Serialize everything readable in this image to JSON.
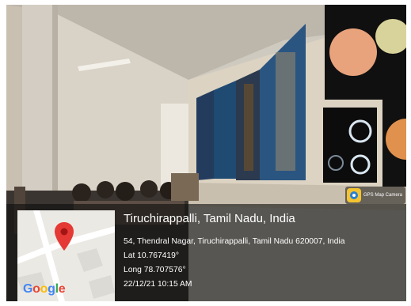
{
  "badge": {
    "app_name": "GPS Map Camera",
    "icon": "gps-map-camera-logo-icon"
  },
  "map": {
    "provider_logo": "Google",
    "pin_icon": "map-pin-icon",
    "pin_color": "#e53935"
  },
  "location": {
    "title": "Tiruchirappalli, Tamil Nadu, India",
    "address": "54, Thendral Nagar, Tiruchirappalli, Tamil Nadu 620007, India",
    "latitude": "Lat 10.767419°",
    "longitude": "Long 78.707576°",
    "datetime": "22/12/21 10:15 AM"
  },
  "colors": {
    "overlay": "#1a1a1a",
    "text": "#ffffff"
  }
}
